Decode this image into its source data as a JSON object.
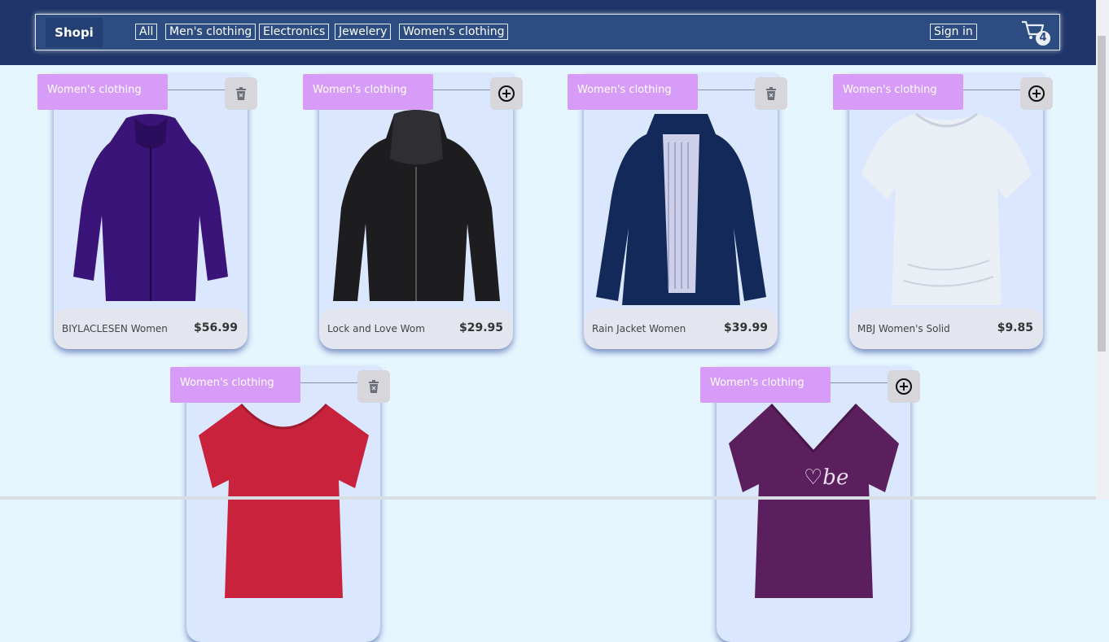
{
  "header": {
    "brand": "Shopi",
    "nav": [
      "All",
      "Men's clothing",
      "Electronics",
      "Jewelery",
      "Women's clothing"
    ],
    "sign_in": "Sign in",
    "cart_count": "4"
  },
  "products": [
    {
      "category": "Women's clothing",
      "name": "BIYLACLESEN Women",
      "price": "$56.99",
      "action": "trash-icon",
      "image": "purple-jacket"
    },
    {
      "category": "Women's clothing",
      "name": "Lock and Love Wom",
      "price": "$29.95",
      "action": "add-icon",
      "image": "black-leather-jacket"
    },
    {
      "category": "Women's clothing",
      "name": "Rain Jacket Women",
      "price": "$39.99",
      "action": "trash-icon",
      "image": "navy-rain-jacket"
    },
    {
      "category": "Women's clothing",
      "name": "MBJ Women's Solid",
      "price": "$9.85",
      "action": "add-icon",
      "image": "white-top"
    },
    {
      "category": "Women's clothing",
      "name": "",
      "price": "",
      "action": "trash-icon",
      "image": "red-tshirt"
    },
    {
      "category": "Women's clothing",
      "name": "",
      "price": "",
      "action": "add-icon",
      "image": "purple-tshirt"
    }
  ]
}
